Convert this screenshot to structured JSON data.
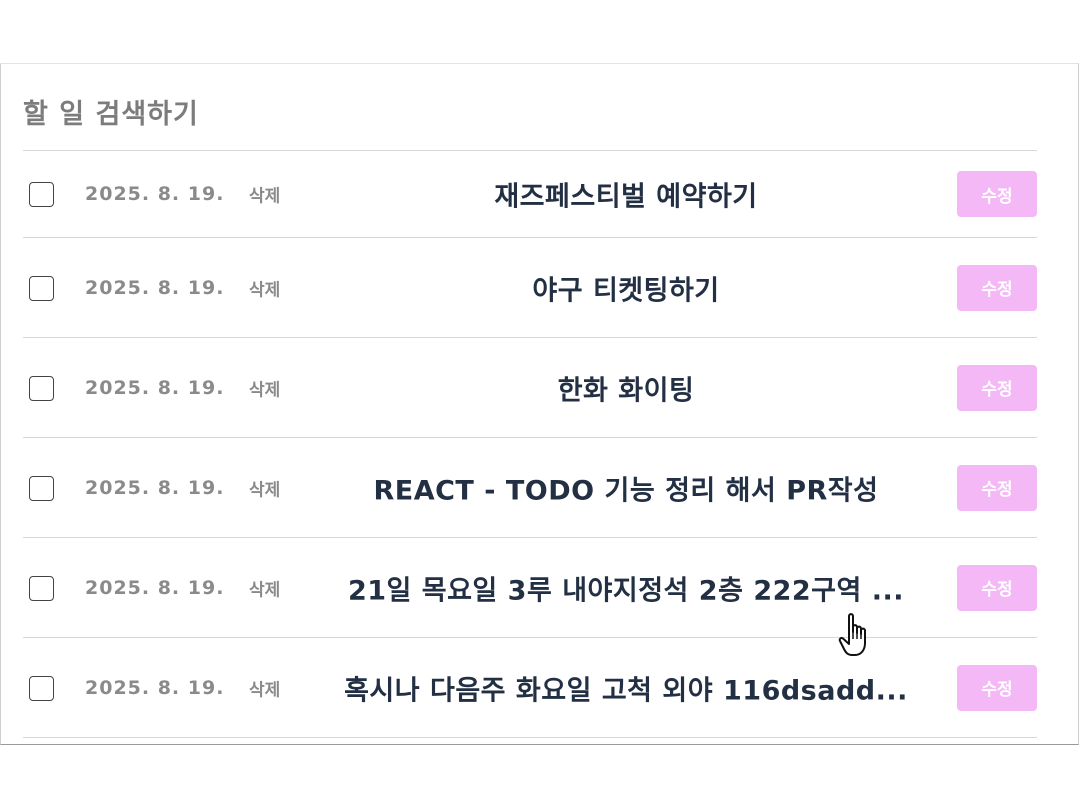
{
  "panel": {
    "title": "할 일 검색하기"
  },
  "todos": [
    {
      "date": "2025. 8. 19.",
      "delete_label": "삭제",
      "text": "재즈페스티벌 예약하기",
      "edit_label": "수정"
    },
    {
      "date": "2025. 8. 19.",
      "delete_label": "삭제",
      "text": "야구 티켓팅하기",
      "edit_label": "수정"
    },
    {
      "date": "2025. 8. 19.",
      "delete_label": "삭제",
      "text": "한화 화이팅",
      "edit_label": "수정"
    },
    {
      "date": "2025. 8. 19.",
      "delete_label": "삭제",
      "text": "REACT - TODO 기능 정리 해서 PR작성",
      "edit_label": "수정"
    },
    {
      "date": "2025. 8. 19.",
      "delete_label": "삭제",
      "text": "21일 목요일 3루 내야지정석 2층 222구역 ...",
      "edit_label": "수정"
    },
    {
      "date": "2025. 8. 19.",
      "delete_label": "삭제",
      "text": "혹시나 다음주 화요일 고척 외야 116dsadd...",
      "edit_label": "수정"
    }
  ],
  "icons": {
    "cursor": "hand-pointer-icon"
  },
  "colors": {
    "edit_button": "#f5b8f7",
    "todo_text": "#233044",
    "muted_text": "#8a8a8a"
  }
}
